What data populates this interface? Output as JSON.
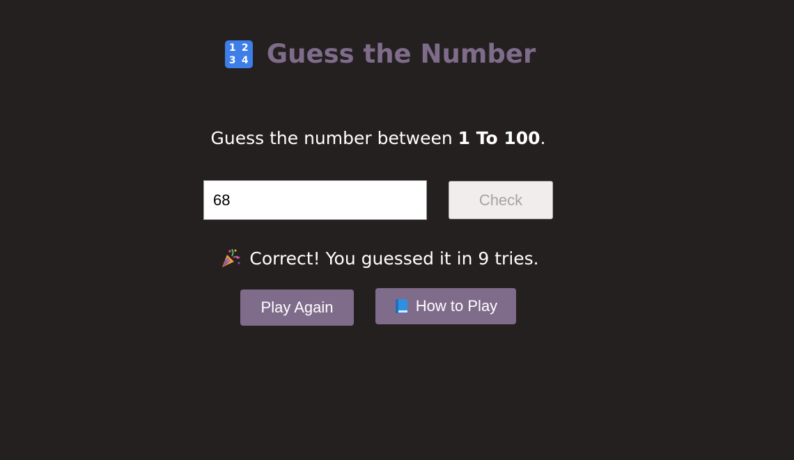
{
  "header": {
    "title": "Guess the Number",
    "title_icon": "input-numbers-icon",
    "title_icon_digits": [
      "1",
      "2",
      "3",
      "4"
    ]
  },
  "instruction": {
    "prefix": "Guess the number between ",
    "range": "1 To 100",
    "suffix": "."
  },
  "guess": {
    "value": "68",
    "check_label": "Check"
  },
  "result": {
    "icon": "party-popper-icon",
    "message": "Correct! You guessed it in 9 tries."
  },
  "actions": {
    "play_again_label": "Play Again",
    "how_to_play_icon": "blue-book-icon",
    "how_to_play_label": "How to Play"
  },
  "colors": {
    "background": "#252020",
    "accent": "#7f6c8b",
    "text": "#ffffff"
  }
}
